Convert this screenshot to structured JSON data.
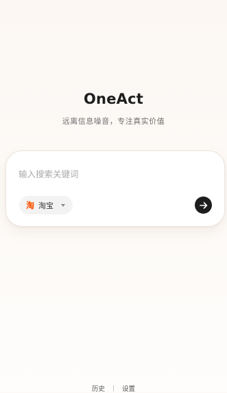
{
  "brand": {
    "title": "OneAct",
    "tagline": "远离信息噪音，专注真实价值"
  },
  "search": {
    "placeholder": "输入搜索关键词",
    "value": ""
  },
  "platform": {
    "icon": "taobao-icon",
    "icon_glyph": "淘",
    "selected": "淘宝",
    "brand_color": "#ff5000"
  },
  "submit": {
    "icon": "arrow-right-icon"
  },
  "footer": {
    "history_label": "历史",
    "settings_label": "设置"
  }
}
